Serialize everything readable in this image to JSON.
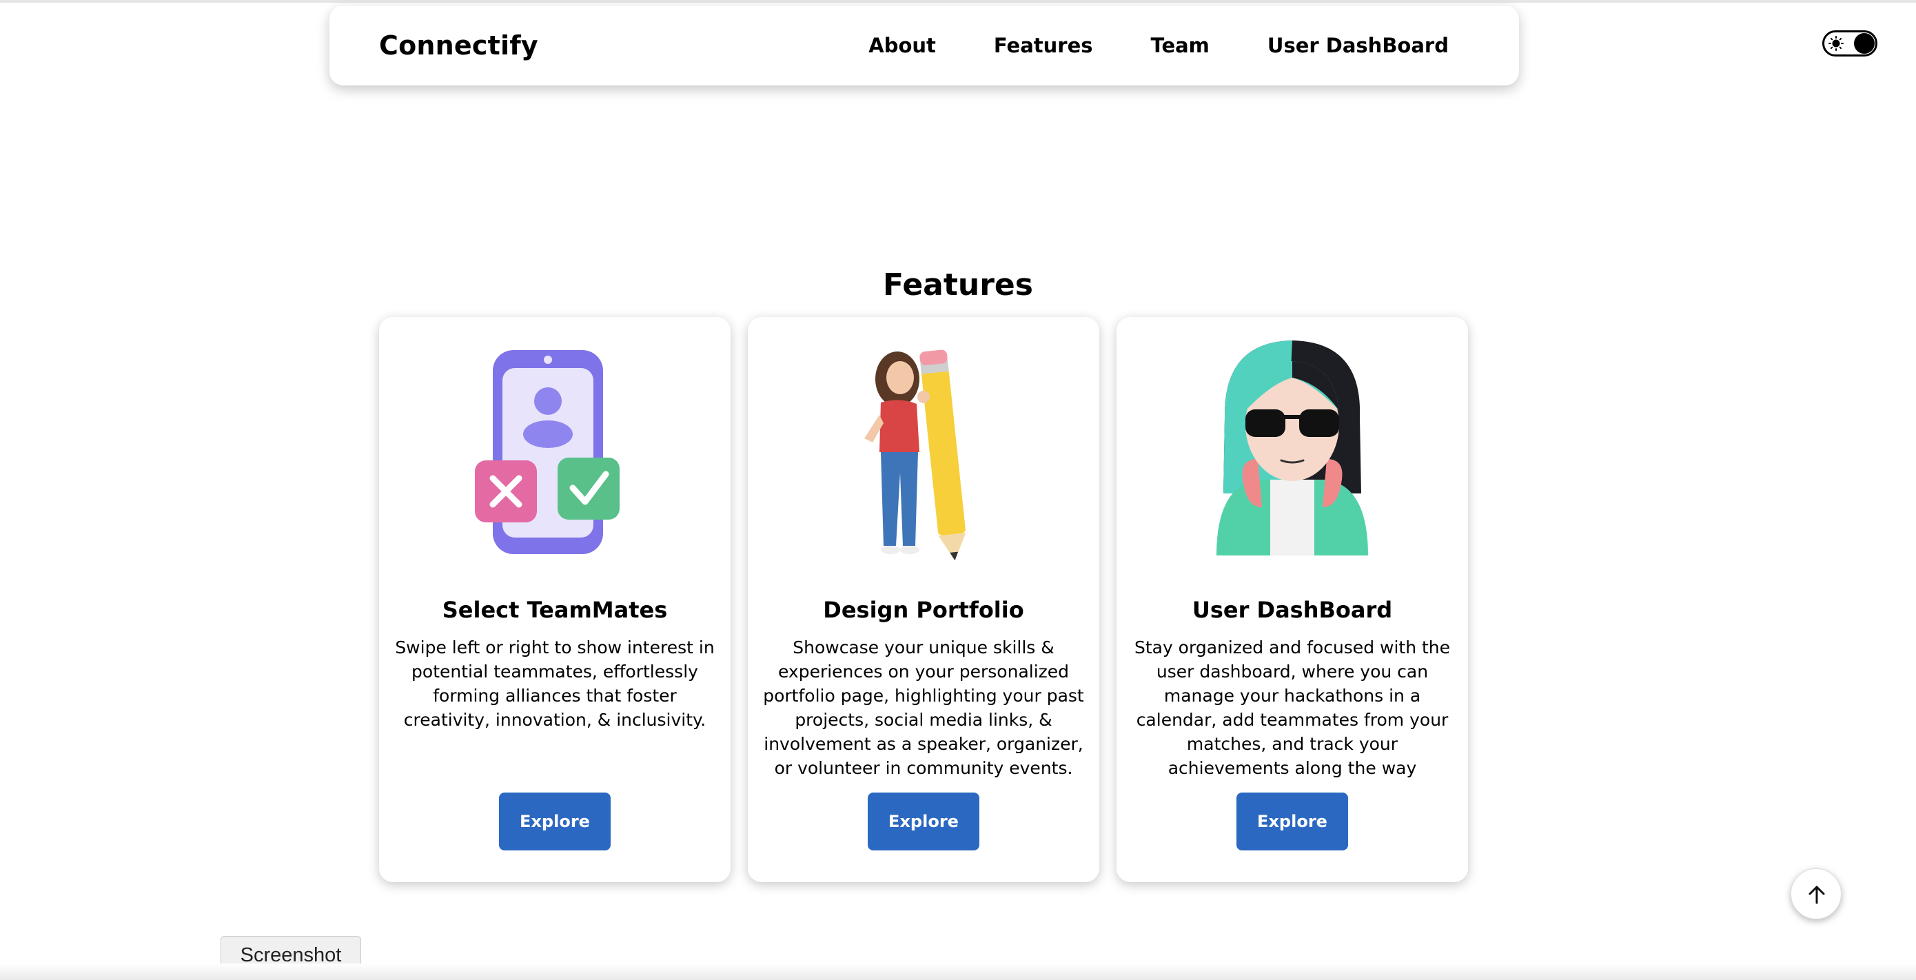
{
  "navbar": {
    "brand": "Connectify",
    "links": [
      "About",
      "Features",
      "Team",
      "User DashBoard"
    ]
  },
  "theme_toggle": {
    "icon": "sun-icon",
    "state": "dark"
  },
  "features": {
    "title": "Features",
    "cards": [
      {
        "icon": "phone-swipe-illustration",
        "title": "Select TeamMates",
        "description": "Swipe left or right to show interest in potential teammates, effortlessly forming alliances that foster creativity, innovation, & inclusivity.",
        "button": "Explore"
      },
      {
        "icon": "woman-with-pencil-illustration",
        "title": "Design Portfolio",
        "description": "Showcase your unique skills & experiences on your personalized portfolio page, highlighting your past projects, social media links, & involvement as a speaker, organizer, or volunteer in community events.",
        "button": "Explore"
      },
      {
        "icon": "avatar-sunglasses-illustration",
        "title": "User DashBoard",
        "description": "Stay organized and focused with the user dashboard, where you can manage your hackathons in a calendar, add teammates from your matches, and track your achievements along the way",
        "button": "Explore"
      }
    ]
  },
  "scroll_top": {
    "icon": "arrow-up-icon"
  },
  "tooltip": {
    "label": "Screenshot"
  },
  "colors": {
    "accent": "#2b68c1",
    "background": "#ffffff",
    "text": "#000000"
  }
}
